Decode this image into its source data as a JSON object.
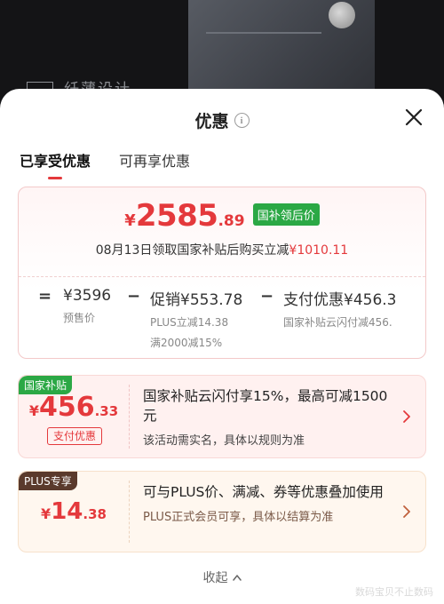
{
  "backdrop": {
    "caption": "纤薄设计"
  },
  "sheet": {
    "title": "优惠"
  },
  "tabs": [
    {
      "label": "已享受优惠",
      "active": true
    },
    {
      "label": "可再享优惠",
      "active": false
    }
  ],
  "price": {
    "currency": "¥",
    "integer": "2585",
    "decimal": ".89",
    "badge": "国补领后价",
    "note_prefix": "08月13日领取国家补贴后购买立减",
    "note_amount": "¥1010.11"
  },
  "calc": {
    "items": [
      {
        "op": "=",
        "value": "¥3596",
        "note": "预售价",
        "note2": ""
      },
      {
        "op": "−",
        "value": "促销¥553.78",
        "note": "PLUS立减14.38",
        "note2": "满2000减15%"
      },
      {
        "op": "−",
        "value": "支付优惠¥456.3",
        "note": "国家补贴云闪付减456.",
        "note2": ""
      }
    ]
  },
  "coupons": [
    {
      "tag": "国家补贴",
      "currency": "¥",
      "integer": "456",
      "decimal": ".33",
      "sub": "支付优惠",
      "title": "国家补贴云闪付享15%，最高可减1500元",
      "desc": "该活动需实名，具体以规则为准"
    },
    {
      "tag": "PLUS专享",
      "currency": "¥",
      "integer": "14",
      "decimal": ".38",
      "sub": "",
      "title": "可与PLUS价、满减、券等优惠叠加使用",
      "desc": "PLUS正式会员可享，具体以结算为准"
    }
  ],
  "collapse_label": "收起",
  "watermark": "数码宝贝不止数码",
  "colors": {
    "accent": "#e4393c",
    "green": "#2ba845",
    "plus_brown": "#5a3a2c"
  }
}
